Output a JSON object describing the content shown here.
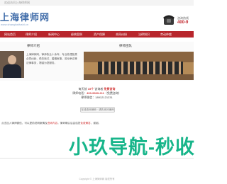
{
  "topbar": {
    "note": "欢迎访问上海律师网"
  },
  "header": {
    "logo_cn": "上海律师网",
    "logo_en": "www.shanghailvshi.cn",
    "hotline_label": "咨询热线",
    "hotline_number": "400-9"
  },
  "nav": {
    "items": [
      "网站首页",
      "律师介绍",
      "新闻中心",
      "经典案例",
      "资产保障",
      "合同纠纷",
      "法律知识",
      "劳动仲裁"
    ]
  },
  "content": {
    "left_title": "律师介绍",
    "intro": "上海律师网，律师执业十余年，专业处理各类合同纠纷、债务追讨、婚姻家事、劳动争议等法律事务，竭诚为您服务。",
    "right_title": "律师团队"
  },
  "notice": {
    "line1_pre": "每天前 ",
    "line1_accent": "15个",
    "line1_mid": " 咨询者 ",
    "line1_accent2": "免费咨询",
    "line2_pre": "律师电话：",
    "line2_accent": "400-9969-211",
    "line2_post": "（免费咨询）",
    "line3_pre": "律师微信：",
    "line3_post": "18912121231"
  },
  "consult_button": "在线咨询律师 · 请先询问律师",
  "tip": {
    "pre": "点击加入律师微信，可以提前说明案情及",
    "link1": "咨询内容",
    "mid": "，律师确认后会给您",
    "link2": "免费解答",
    "post": "，谢谢。"
  },
  "watermark": "小玖导航-秒收",
  "footer": "Copyright © 上海律师网 版权所有"
}
